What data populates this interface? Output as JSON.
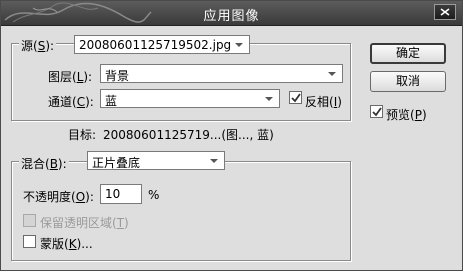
{
  "window": {
    "title": "应用图像"
  },
  "source": {
    "label": "源(",
    "key": "S",
    "label_end": "):",
    "file": "20080601125719502.jpg"
  },
  "layer": {
    "label": "图层(",
    "key": "L",
    "label_end": "):",
    "value": "背景"
  },
  "channel": {
    "label": "通道(",
    "key": "C",
    "label_end": "):",
    "value": "蓝"
  },
  "invert": {
    "label": "反相(",
    "key": "I",
    "label_end": ")",
    "checked": true
  },
  "target": {
    "label": "目标:",
    "value": "20080601125719...(图..., 蓝)"
  },
  "blending": {
    "label": "混合(",
    "key": "B",
    "label_end": "):",
    "value": "正片叠底"
  },
  "opacity": {
    "label": "不透明度(",
    "key": "O",
    "label_end": "):",
    "value": "10",
    "unit": "%"
  },
  "preserve_transparency": {
    "label": "保留透明区域(",
    "key": "T",
    "label_end": ")",
    "checked": false,
    "enabled": false
  },
  "mask": {
    "label": "蒙版(",
    "key": "K",
    "label_end": ")...",
    "checked": false
  },
  "buttons": {
    "ok": "确定",
    "cancel": "取消"
  },
  "preview": {
    "label": "预览(",
    "key": "P",
    "label_end": ")",
    "checked": true
  }
}
